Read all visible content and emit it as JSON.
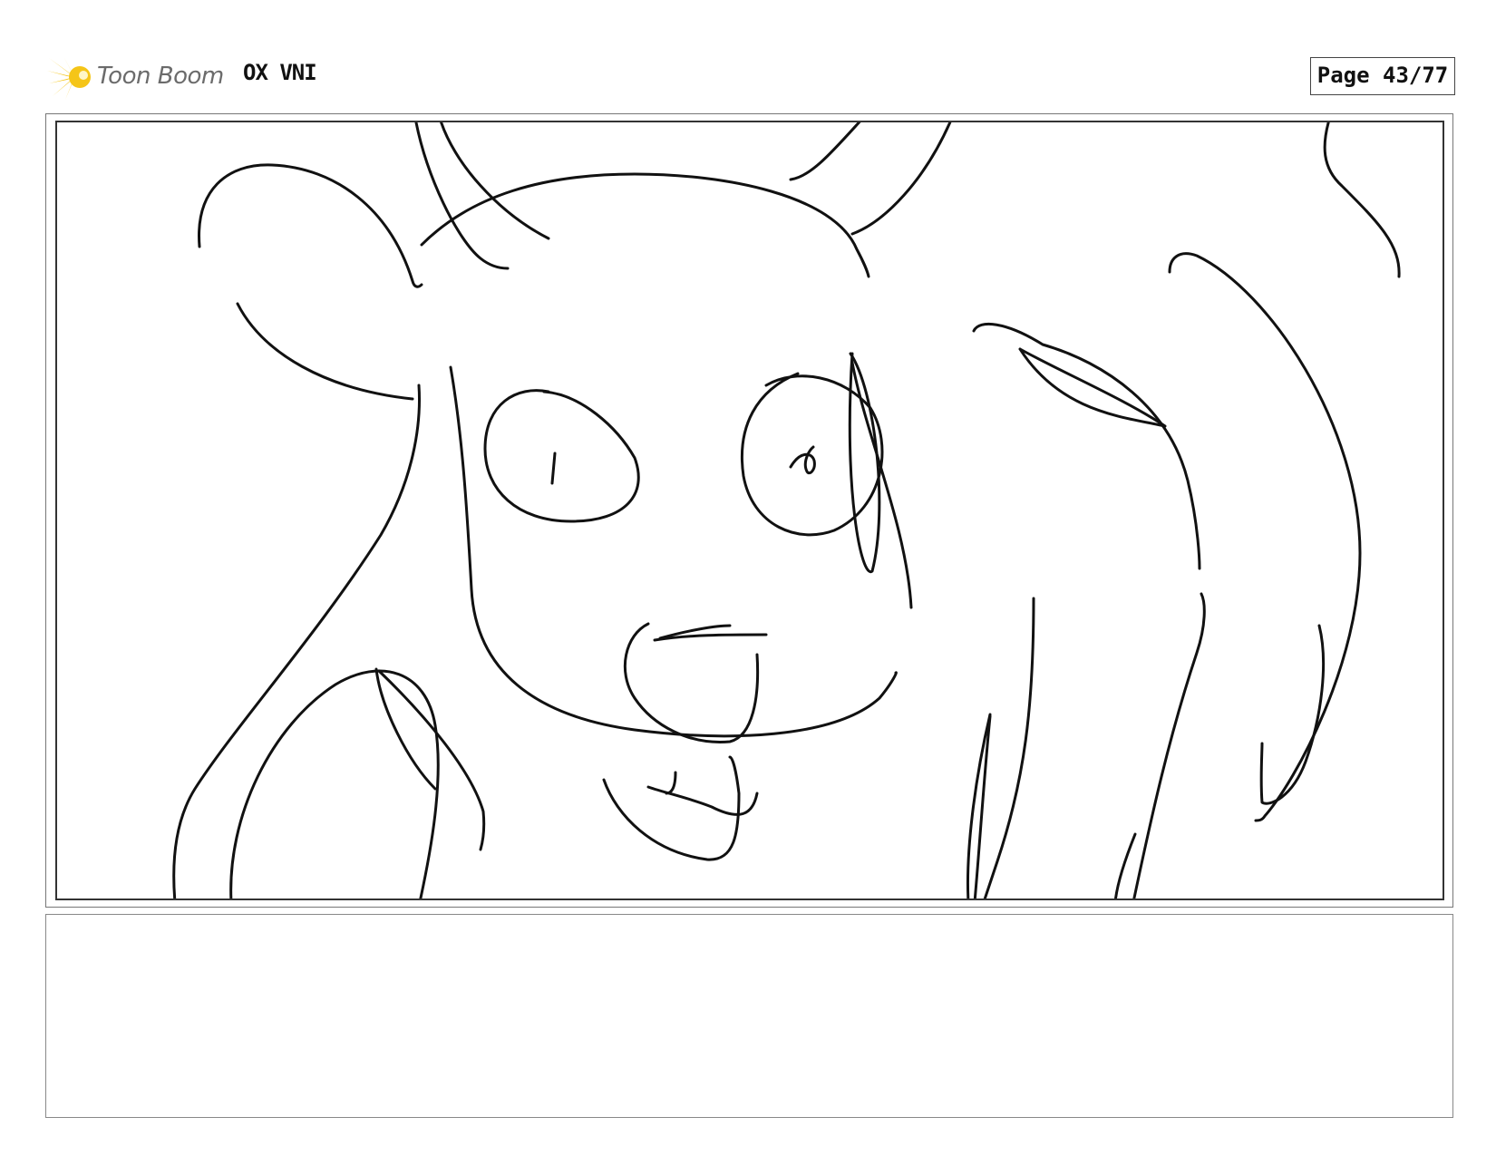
{
  "header": {
    "logo_text": "Toon Boom",
    "logo_icon": "sunburst-logo",
    "project_title": "OX VNI",
    "page_label": "Page 43/77"
  },
  "panel": {
    "content": "pencil-sketch"
  },
  "caption": {
    "text": ""
  },
  "colors": {
    "logo_yellow": "#f5c518",
    "logo_text": "#6b6b6b",
    "sketch_stroke": "#111111"
  }
}
